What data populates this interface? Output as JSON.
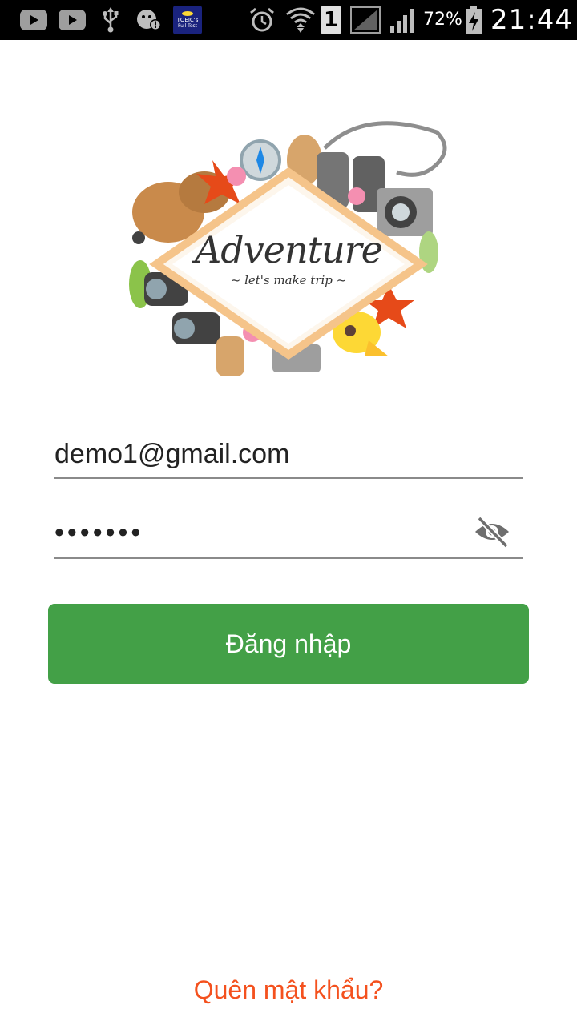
{
  "status_bar": {
    "icons": [
      "youtube-icon",
      "youtube-icon",
      "usb-icon",
      "android-debug-icon",
      "toeic-app-icon",
      "alarm-icon",
      "wifi-icon",
      "sim-1-icon",
      "signal-icon",
      "signal-icon",
      "battery-charging-icon"
    ],
    "toeic_label_1": "TOEIC's",
    "toeic_label_2": "Full Test",
    "sim_label": "1",
    "battery_percent": "72%",
    "time": "21:44"
  },
  "logo": {
    "title": "Adventure",
    "subtitle": "~ let's make trip ~"
  },
  "login_form": {
    "email_value": "demo1@gmail.com",
    "password_value": "•••••••",
    "toggle_icon": "eye-off-icon",
    "submit_label": "Đăng nhập"
  },
  "forgot_password_label": "Quên mật khẩu?",
  "colors": {
    "primary_button": "#43a047",
    "link": "#f4511e",
    "status_bar": "#000000"
  }
}
